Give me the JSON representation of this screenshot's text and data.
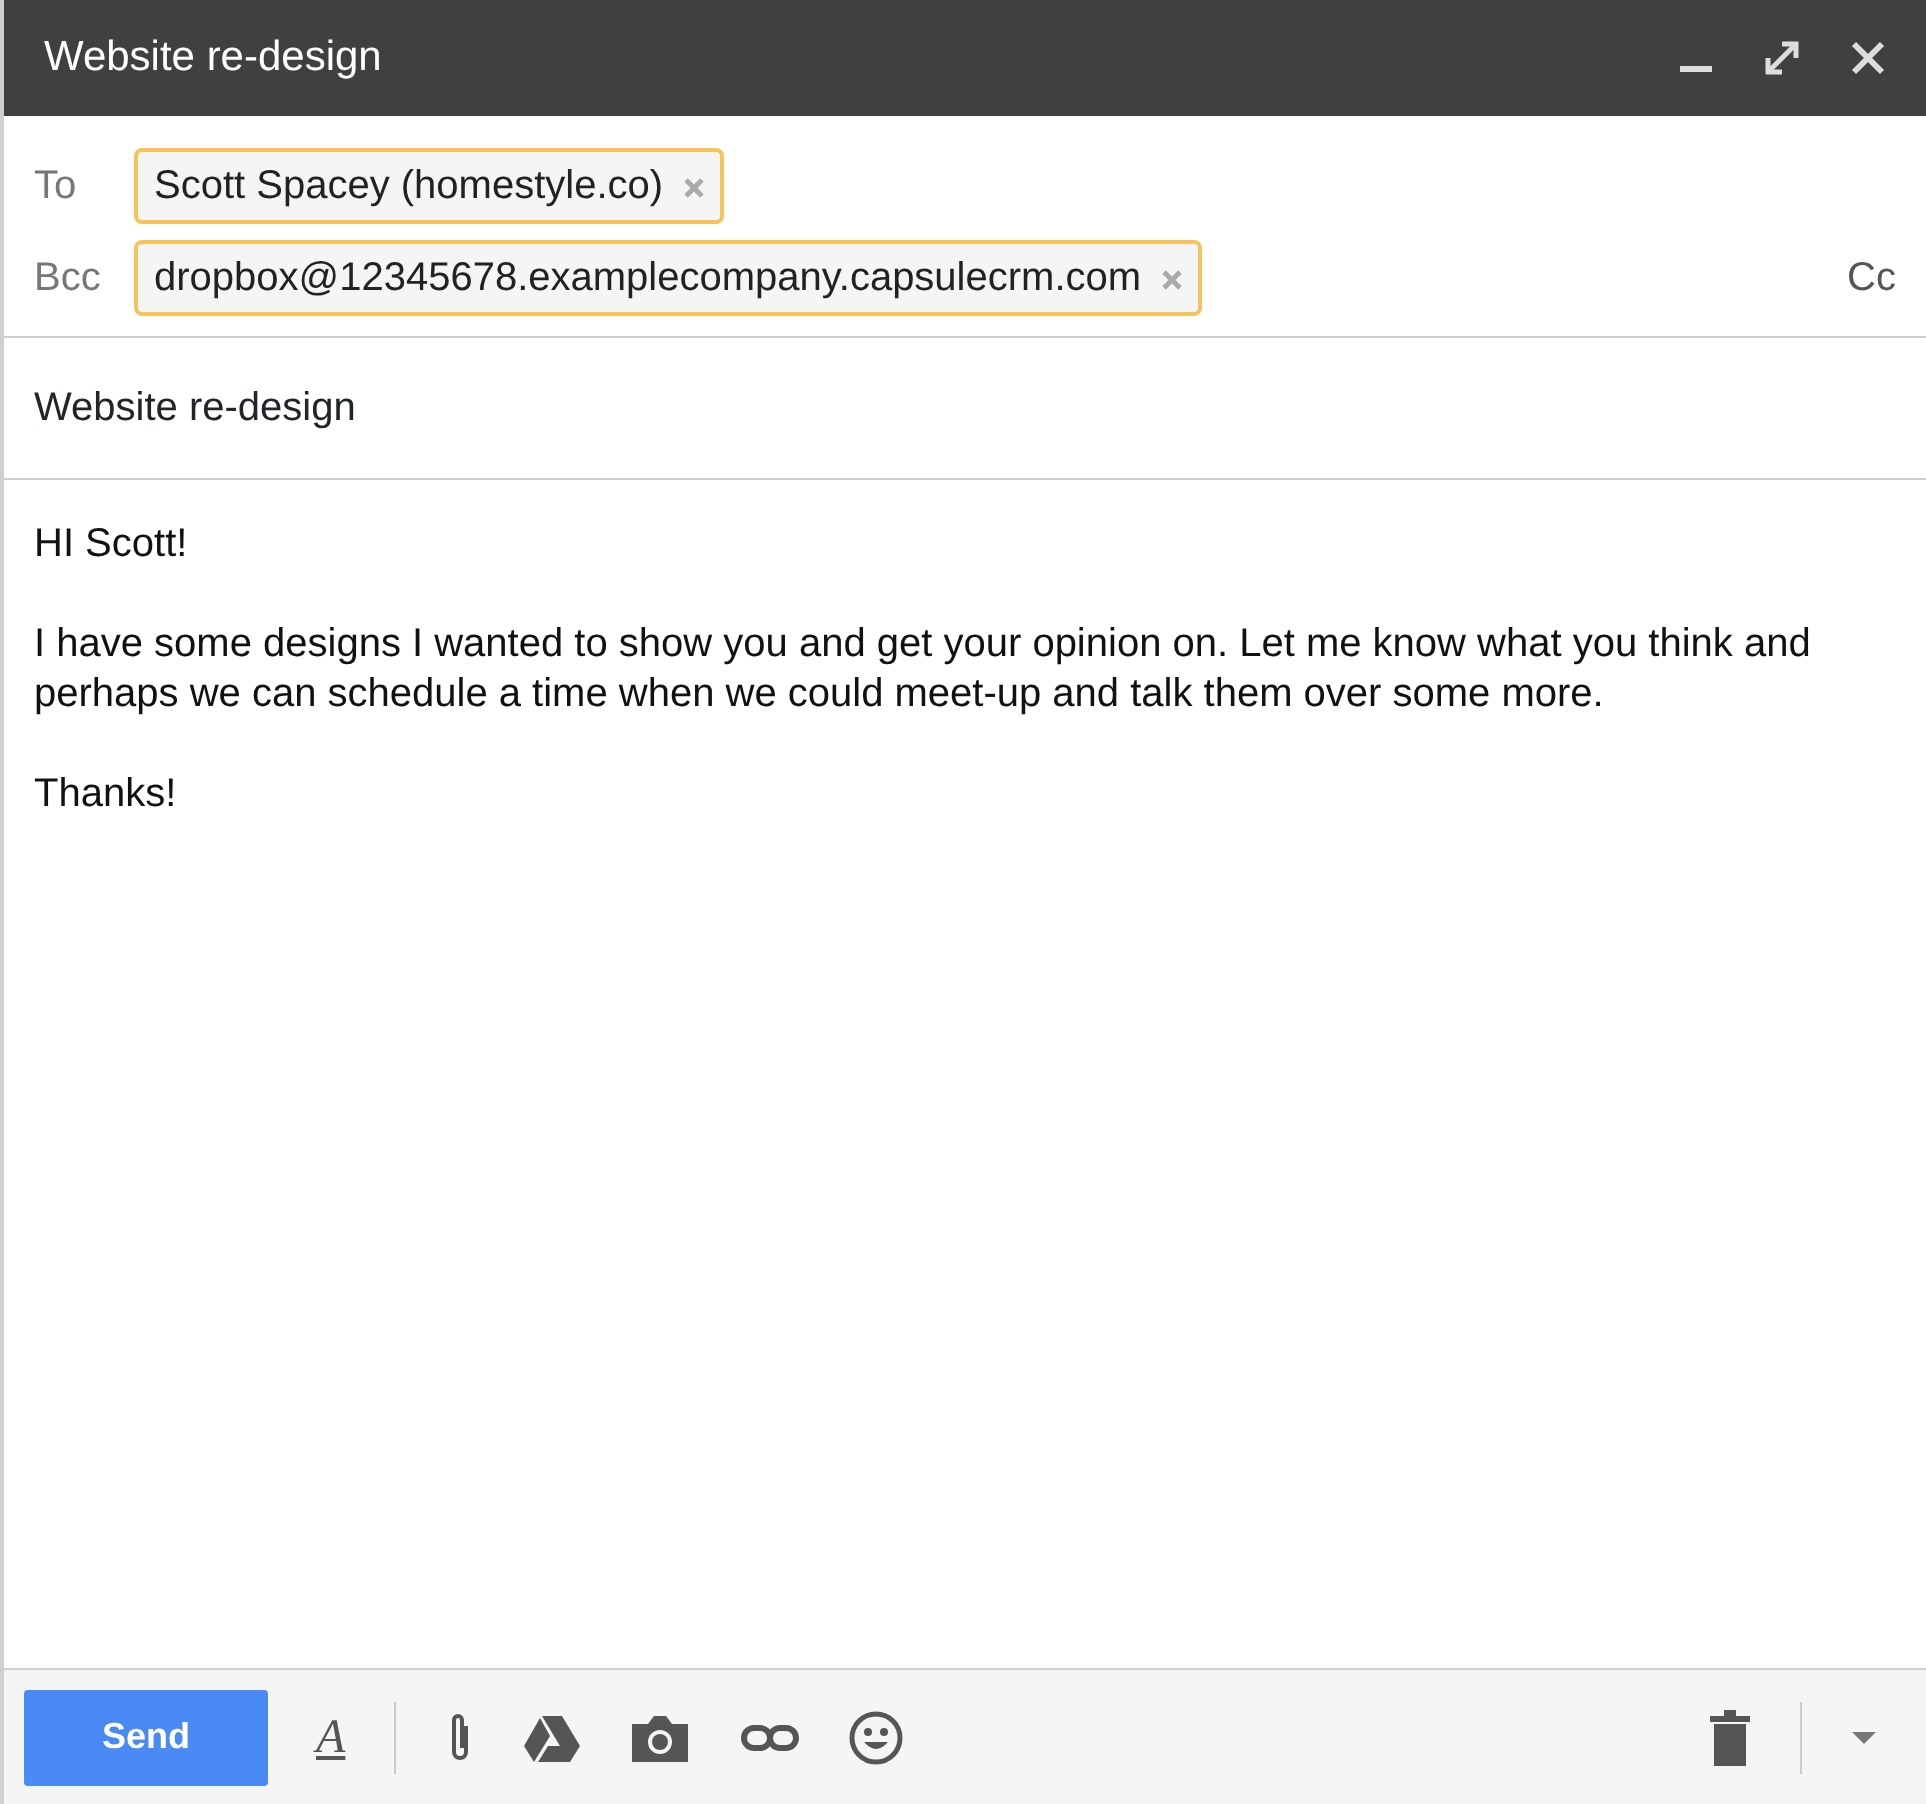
{
  "window": {
    "title": "Website re-design"
  },
  "recipients": [
    {
      "label": "To",
      "chips": [
        "Scott Spacey (homestyle.co)"
      ]
    },
    {
      "label": "Bcc",
      "chips": [
        "dropbox@12345678.examplecompany.capsulecrm.com"
      ],
      "extra": "Cc"
    }
  ],
  "subject": "Website re-design",
  "body": [
    "HI Scott!",
    "I have some designs I wanted to show you and get your opinion on. Let me know what you think and perhaps we can schedule a time when we could meet-up and talk them over some more.",
    "Thanks!"
  ],
  "toolbar": {
    "send": "Send",
    "format_glyph": "A"
  }
}
